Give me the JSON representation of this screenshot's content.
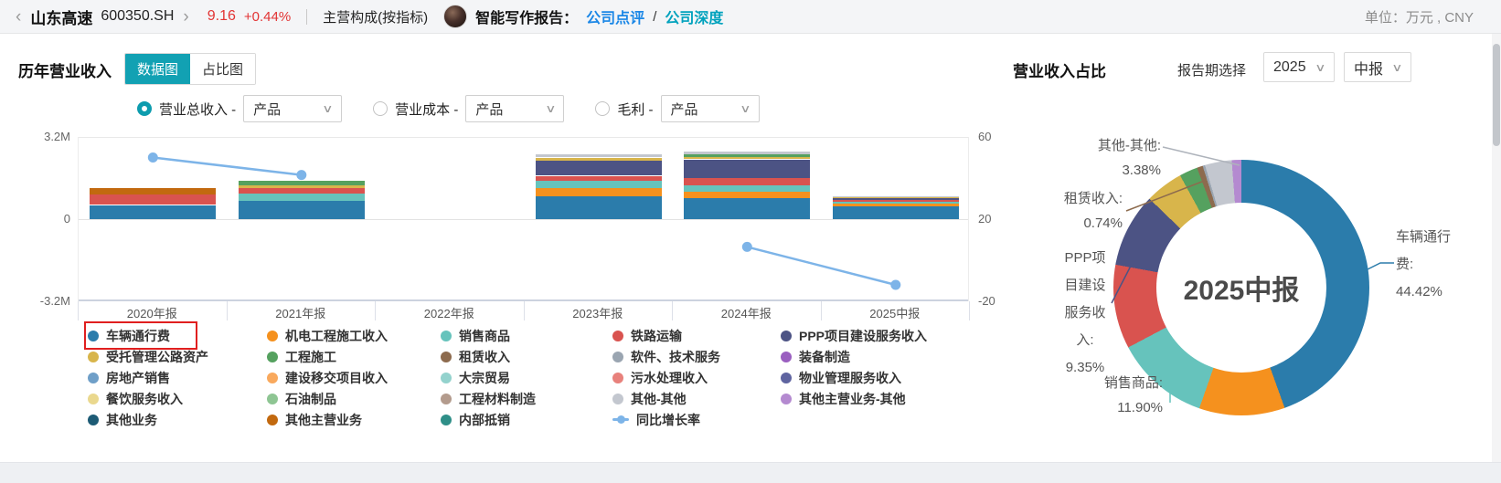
{
  "topbar": {
    "back_icon": "‹",
    "stock_name": "山东高速",
    "stock_code": "600350.SH",
    "forward_icon": "›",
    "price": "9.16",
    "change_pct": "+0.44%",
    "section_label": "主营构成(按指标)",
    "report_label": "智能写作报告：",
    "report_link_1": "公司点评",
    "report_link_sep": "/",
    "report_link_2": "公司深度",
    "unit_label": "单位：万元 , CNY"
  },
  "left_panel": {
    "title": "历年营业收入",
    "tabs": [
      {
        "label": "数据图",
        "active": true
      },
      {
        "label": "占比图",
        "active": false
      }
    ],
    "controls": [
      {
        "label": "营业总收入 -",
        "selected": true,
        "dropdown_value": "产品"
      },
      {
        "label": "营业成本 -",
        "selected": false,
        "dropdown_value": "产品"
      },
      {
        "label": "毛利 -",
        "selected": false,
        "dropdown_value": "产品"
      }
    ],
    "dropdown_icon": "∨"
  },
  "right_panel": {
    "title": "营业收入占比",
    "period_label": "报告期选择",
    "year_value": "2025",
    "period_value": "中报",
    "dropdown_icon": "∨"
  },
  "series_colors": {
    "车辆通行费": "#2b7cab",
    "受托管理公路资产": "#d8b54b",
    "房地产销售": "#6f9fc8",
    "餐饮服务收入": "#ead88e",
    "其他业务": "#1d5b75",
    "机电工程施工收入": "#f5911e",
    "工程施工": "#55a15f",
    "建设移交项目收入": "#f9a95d",
    "石油制品": "#8ec593",
    "其他主营业务": "#c2690f",
    "销售商品": "#66c3bc",
    "租赁收入": "#8d6b4e",
    "大宗贸易": "#93d2cd",
    "工程材料制造": "#b39b8d",
    "内部抵销": "#2f8f88",
    "铁路运输": "#d9534f",
    "软件、技术服务": "#9aa5b1",
    "污水处理收入": "#e8817c",
    "其他-其他": "#c3c7cf",
    "同比增长率": "#7db4e8",
    "PPP项目建设服务收入": "#4c5384",
    "装备制造": "#9a5fc0",
    "物业管理服务收入": "#5f64a0",
    "其他主营业务-其他": "#b48ad0"
  },
  "legend": {
    "columns": [
      [
        "车辆通行费",
        "受托管理公路资产",
        "房地产销售",
        "餐饮服务收入",
        "其他业务"
      ],
      [
        "机电工程施工收入",
        "工程施工",
        "建设移交项目收入",
        "石油制品",
        "其他主营业务"
      ],
      [
        "销售商品",
        "租赁收入",
        "大宗贸易",
        "工程材料制造",
        "内部抵销"
      ],
      [
        "铁路运输",
        "软件、技术服务",
        "污水处理收入",
        "其他-其他",
        "同比增长率"
      ],
      [
        "PPP项目建设服务收入",
        "装备制造",
        "物业管理服务收入",
        "其他主营业务-其他"
      ]
    ],
    "highlighted_item": "车辆通行费"
  },
  "chart_data": [
    {
      "id": "revenue_by_year",
      "type": "bar",
      "subtype": "stacked-bars-with-line",
      "title": "历年营业收入",
      "unit": "万元",
      "categories": [
        "2020年报",
        "2021年报",
        "2022年报",
        "2023年报",
        "2024年报",
        "2025中报"
      ],
      "y_left": {
        "ticks": [
          "3.2M",
          "0",
          "-3.2M"
        ],
        "min": -3.2,
        "max": 3.2
      },
      "y_right": {
        "ticks": [
          "60",
          "20",
          "-20"
        ],
        "min": -20,
        "max": 60
      },
      "stacks": [
        {
          "category": "2020年报",
          "segments": [
            {
              "series": "车辆通行费",
              "value": 0.55
            },
            {
              "series": "铁路运输",
              "value": 0.43
            },
            {
              "series": "其他主营业务",
              "value": 0.23
            }
          ]
        },
        {
          "category": "2021年报",
          "segments": [
            {
              "series": "车辆通行费",
              "value": 0.71
            },
            {
              "series": "销售商品",
              "value": 0.28
            },
            {
              "series": "铁路运输",
              "value": 0.21
            },
            {
              "series": "受托管理公路资产",
              "value": 0.12
            },
            {
              "series": "工程施工",
              "value": 0.19
            }
          ]
        },
        {
          "category": "2022年报",
          "segments": []
        },
        {
          "category": "2023年报",
          "segments": [
            {
              "series": "车辆通行费",
              "value": 0.88
            },
            {
              "series": "机电工程施工收入",
              "value": 0.32
            },
            {
              "series": "销售商品",
              "value": 0.28
            },
            {
              "series": "铁路运输",
              "value": 0.21
            },
            {
              "series": "PPP项目建设服务收入",
              "value": 0.6
            },
            {
              "series": "受托管理公路资产",
              "value": 0.11
            },
            {
              "series": "其他-其他",
              "value": 0.12
            }
          ]
        },
        {
          "category": "2024年报",
          "segments": [
            {
              "series": "车辆通行费",
              "value": 0.81
            },
            {
              "series": "机电工程施工收入",
              "value": 0.25
            },
            {
              "series": "销售商品",
              "value": 0.25
            },
            {
              "series": "铁路运输",
              "value": 0.28
            },
            {
              "series": "PPP项目建设服务收入",
              "value": 0.74
            },
            {
              "series": "受托管理公路资产",
              "value": 0.1
            },
            {
              "series": "工程施工",
              "value": 0.1
            },
            {
              "series": "其他-其他",
              "value": 0.11
            }
          ]
        },
        {
          "category": "2025中报",
          "segments": [
            {
              "series": "车辆通行费",
              "value": 0.5
            },
            {
              "series": "机电工程施工收入",
              "value": 0.1
            },
            {
              "series": "销售商品",
              "value": 0.08
            },
            {
              "series": "铁路运输",
              "value": 0.07
            },
            {
              "series": "PPP项目建设服务收入",
              "value": 0.06
            },
            {
              "series": "受托管理公路资产",
              "value": 0.04
            },
            {
              "series": "其他-其他",
              "value": 0.04
            }
          ]
        }
      ],
      "line_series": {
        "name": "同比增长率",
        "axis": "right",
        "values": [
          50.0,
          41.5,
          null,
          null,
          6.5,
          -12.0
        ]
      }
    },
    {
      "id": "revenue_share",
      "type": "pie",
      "subtype": "donut",
      "title": "营业收入占比",
      "center_label": "2025中报",
      "slices": [
        {
          "name": "车辆通行费",
          "value": 44.42
        },
        {
          "name": "机电工程施工收入",
          "value": 10.8
        },
        {
          "name": "销售商品",
          "value": 11.9
        },
        {
          "name": "铁路运输",
          "value": 10.6
        },
        {
          "name": "PPP项目建设服务收入",
          "value": 9.35
        },
        {
          "name": "受托管理公路资产",
          "value": 4.8
        },
        {
          "name": "工程施工",
          "value": 2.3
        },
        {
          "name": "租赁收入",
          "value": 0.74
        },
        {
          "name": "软件、技术服务",
          "value": 0.3
        },
        {
          "name": "其他-其他",
          "value": 3.38
        },
        {
          "name": "其他主营业务-其他",
          "value": 1.21
        }
      ],
      "callouts": [
        {
          "label": "其他-其他:",
          "value": "3.38%"
        },
        {
          "label": "租赁收入:",
          "value": "0.74%"
        },
        {
          "label": "PPP项目建设服务收入:",
          "value": "9.35%"
        },
        {
          "label": "销售商品:",
          "value": "11.90%"
        },
        {
          "label": "车辆通行费:",
          "value": "44.42%"
        }
      ]
    }
  ]
}
